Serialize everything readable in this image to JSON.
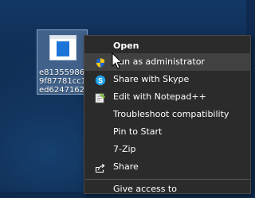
{
  "desktop": {
    "file_label_lines": "e81355986b\n9f87781cc1\ned6247162"
  },
  "context_menu": {
    "items": [
      {
        "label": "Open",
        "icon": "none"
      },
      {
        "label": "Run as administrator",
        "icon": "uac-shield-icon"
      },
      {
        "label": "Share with Skype",
        "icon": "skype-icon"
      },
      {
        "label": "Edit with Notepad++",
        "icon": "notepadpp-icon"
      },
      {
        "label": "Troubleshoot compatibility",
        "icon": "none"
      },
      {
        "label": "Pin to Start",
        "icon": "none"
      },
      {
        "label": "7-Zip",
        "icon": "none"
      },
      {
        "label": "Share",
        "icon": "share-icon"
      },
      {
        "label": "Give access to",
        "icon": "none"
      }
    ],
    "highlighted_item": "Run as administrator"
  },
  "colors": {
    "menu_background": "#2b2b2b",
    "menu_highlight": "#414141",
    "menu_text": "#ffffff",
    "selection_blue": "#1c74d8"
  }
}
